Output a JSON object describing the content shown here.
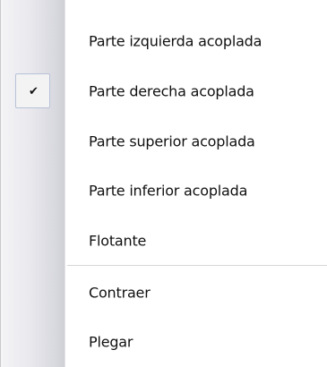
{
  "menu": {
    "items": [
      {
        "label": "Parte izquierda acoplada",
        "checked": false
      },
      {
        "label": "Parte derecha acoplada",
        "checked": true
      },
      {
        "label": "Parte superior acoplada",
        "checked": false
      },
      {
        "label": "Parte inferior acoplada",
        "checked": false
      },
      {
        "label": "Flotante",
        "checked": false
      },
      {
        "label": "Contraer",
        "checked": false
      },
      {
        "label": "Plegar",
        "checked": false
      }
    ],
    "check_glyph": "✔"
  }
}
